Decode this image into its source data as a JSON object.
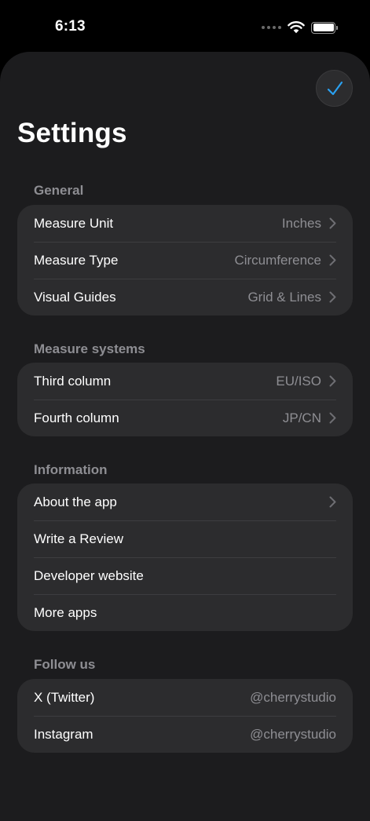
{
  "status_bar": {
    "time": "6:13",
    "icons": [
      "signal-dots-icon",
      "wifi-icon",
      "battery-icon"
    ]
  },
  "header": {
    "title": "Settings",
    "done_icon": "checkmark-icon"
  },
  "colors": {
    "background": "#000000",
    "sheet": "#1c1c1e",
    "group": "#2c2c2e",
    "secondary_text": "#8e8e93",
    "accent": "#2aa0f0"
  },
  "sections": {
    "general": {
      "title": "General",
      "rows": [
        {
          "label": "Measure Unit",
          "value": "Inches",
          "chevron": true
        },
        {
          "label": "Measure Type",
          "value": "Circumference",
          "chevron": true
        },
        {
          "label": "Visual Guides",
          "value": "Grid & Lines",
          "chevron": true
        }
      ]
    },
    "systems": {
      "title": "Measure systems",
      "rows": [
        {
          "label": "Third column",
          "value": "EU/ISO",
          "chevron": true
        },
        {
          "label": "Fourth column",
          "value": "JP/CN",
          "chevron": true
        }
      ]
    },
    "information": {
      "title": "Information",
      "rows": [
        {
          "label": "About the app",
          "chevron": true
        },
        {
          "label": "Write a Review"
        },
        {
          "label": "Developer website"
        },
        {
          "label": "More apps"
        }
      ]
    },
    "follow": {
      "title": "Follow us",
      "rows": [
        {
          "label": "X (Twitter)",
          "value": "@cherrystudio"
        },
        {
          "label": "Instagram",
          "value": "@cherrystudio"
        }
      ]
    }
  }
}
